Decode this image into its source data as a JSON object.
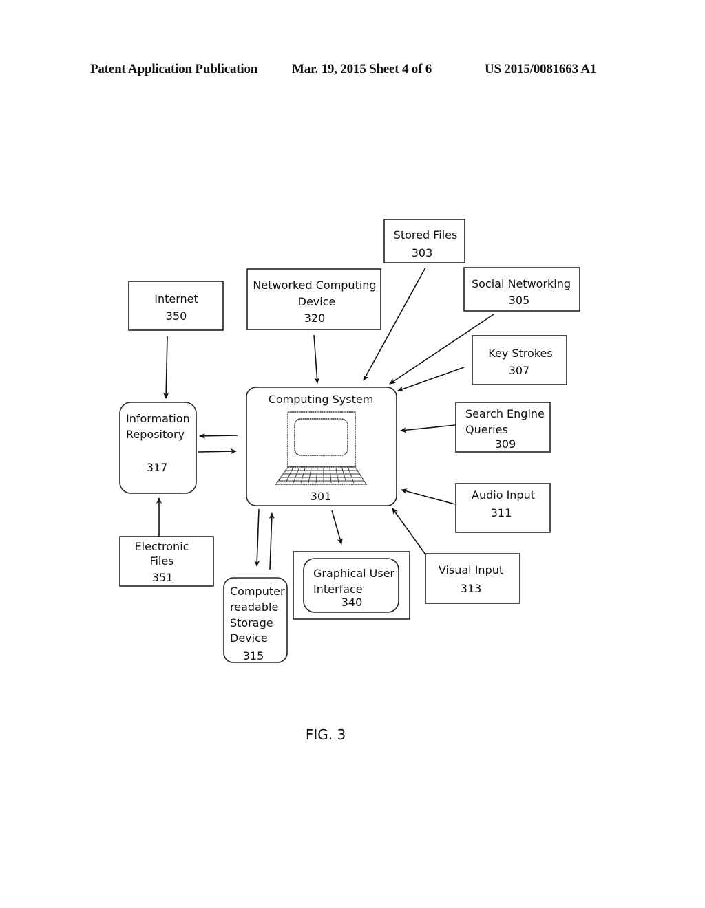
{
  "header": {
    "publication": "Patent Application Publication",
    "date_sheet": "Mar. 19, 2015  Sheet 4 of 6",
    "number": "US 2015/0081663 A1"
  },
  "figure_label": "FIG. 3",
  "nodes": {
    "computing_system": {
      "lines": [
        "Computing System"
      ],
      "ref": "301",
      "icon": "laptop-icon"
    },
    "stored_files": {
      "lines": [
        "Stored Files"
      ],
      "ref": "303"
    },
    "social_networking": {
      "lines": [
        "Social Networking"
      ],
      "ref": "305"
    },
    "key_strokes": {
      "lines": [
        "Key Strokes"
      ],
      "ref": "307"
    },
    "search_engine_queries": {
      "lines": [
        "Search Engine",
        "Queries"
      ],
      "ref": "309"
    },
    "audio_input": {
      "lines": [
        "Audio Input"
      ],
      "ref": "311"
    },
    "visual_input": {
      "lines": [
        "Visual Input"
      ],
      "ref": "313"
    },
    "storage_device": {
      "lines": [
        "Computer",
        "readable",
        "Storage",
        "Device"
      ],
      "ref": "315"
    },
    "information_repository": {
      "lines": [
        "Information",
        "Repository"
      ],
      "ref": "317"
    },
    "networked_device": {
      "lines": [
        "Networked Computing",
        "Device"
      ],
      "ref": "320"
    },
    "gui": {
      "lines": [
        "Graphical User",
        "Interface"
      ],
      "ref": "340"
    },
    "internet": {
      "lines": [
        "Internet"
      ],
      "ref": "350"
    },
    "electronic_files": {
      "lines": [
        "Electronic",
        "Files"
      ],
      "ref": "351"
    }
  },
  "edges": [
    {
      "from": "internet",
      "to": "information_repository"
    },
    {
      "from": "networked_device",
      "to": "computing_system"
    },
    {
      "from": "stored_files",
      "to": "computing_system"
    },
    {
      "from": "social_networking",
      "to": "computing_system"
    },
    {
      "from": "key_strokes",
      "to": "computing_system"
    },
    {
      "from": "search_engine_queries",
      "to": "computing_system"
    },
    {
      "from": "audio_input",
      "to": "computing_system"
    },
    {
      "from": "visual_input",
      "to": "computing_system"
    },
    {
      "from": "computing_system",
      "to": "information_repository"
    },
    {
      "from": "information_repository",
      "to": "computing_system"
    },
    {
      "from": "electronic_files",
      "to": "information_repository"
    },
    {
      "from": "computing_system",
      "to": "storage_device"
    },
    {
      "from": "storage_device",
      "to": "computing_system"
    },
    {
      "from": "computing_system",
      "to": "gui"
    }
  ]
}
